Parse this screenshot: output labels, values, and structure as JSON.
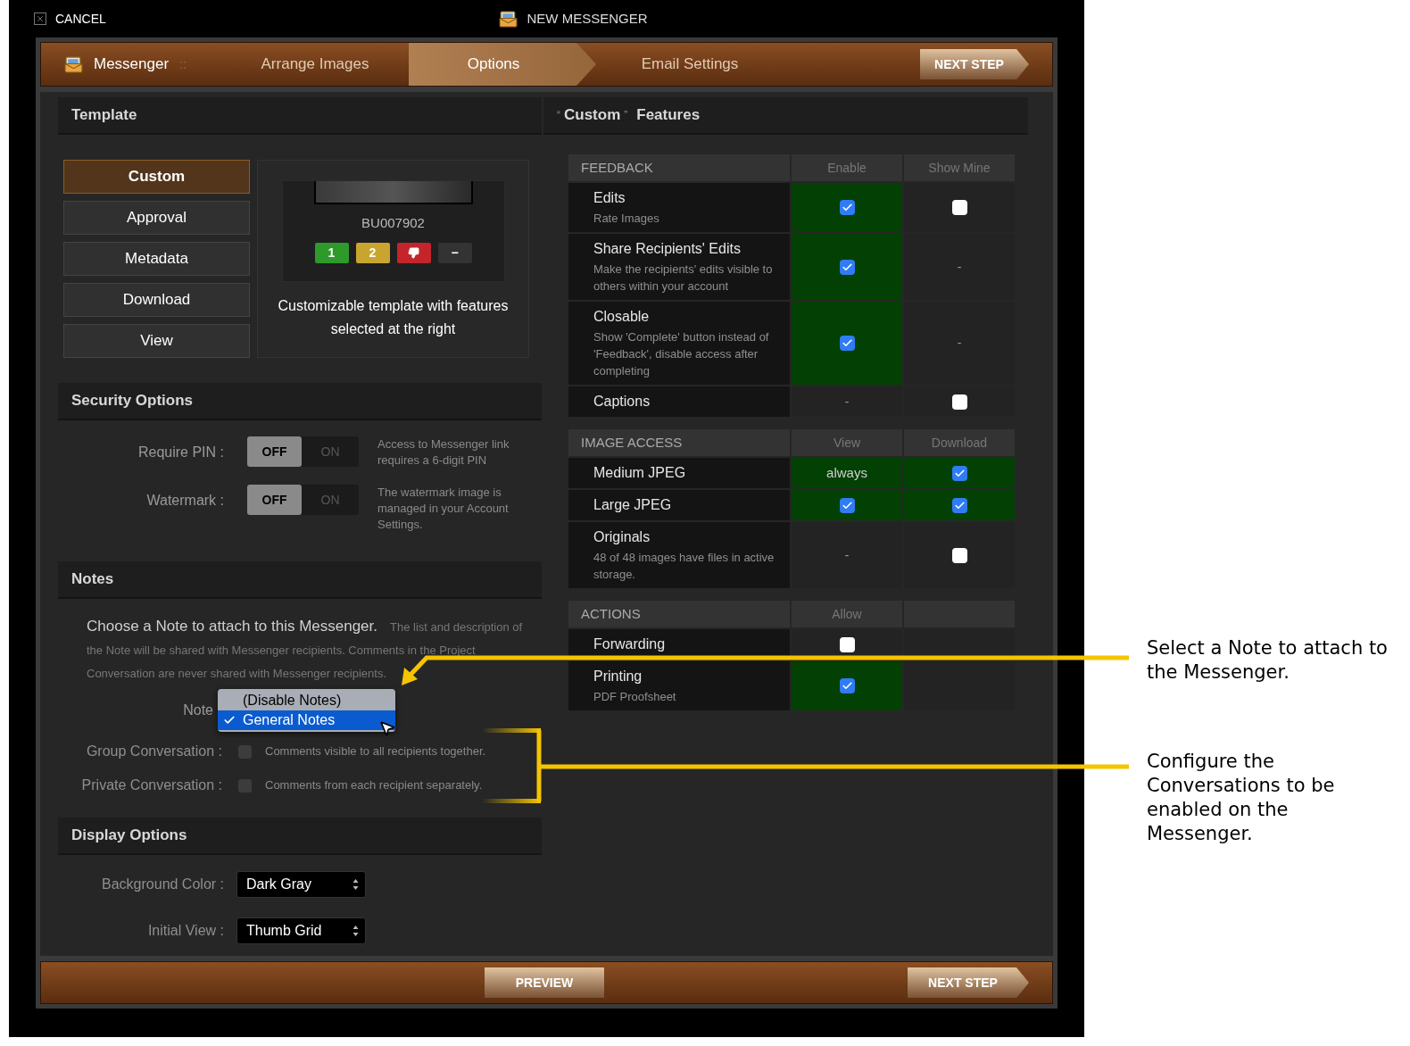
{
  "top_bar": {
    "cancel": "CANCEL",
    "title": "NEW MESSENGER"
  },
  "steps": [
    {
      "kind": "home",
      "label": "Messenger",
      "suffix": "::",
      "selected": false
    },
    {
      "kind": "step",
      "label": "Arrange Images",
      "selected": false
    },
    {
      "kind": "step",
      "label": "Options",
      "selected": true
    },
    {
      "kind": "step",
      "label": "Email Settings",
      "selected": false
    }
  ],
  "next_step": "NEXT STEP",
  "template": {
    "title": "Template",
    "options": [
      {
        "label": "Custom",
        "selected": true
      },
      {
        "label": "Approval",
        "selected": false
      },
      {
        "label": "Metadata",
        "selected": false
      },
      {
        "label": "Download",
        "selected": false
      },
      {
        "label": "View",
        "selected": false
      }
    ],
    "preview": {
      "code": "BU007902",
      "ratings": [
        {
          "kind": "number",
          "label": "1",
          "color": "#2e9a2a"
        },
        {
          "kind": "number",
          "label": "2",
          "color": "#c9a530"
        },
        {
          "kind": "thumbs-down",
          "color": "#c3252a"
        },
        {
          "kind": "number",
          "label": "−",
          "color": "#333333"
        }
      ]
    },
    "description": "Customizable template with features selected at the right"
  },
  "security": {
    "title": "Security Options",
    "rows": [
      {
        "label": "Require PIN :",
        "toggle": {
          "off_label": "OFF",
          "on_label": "ON",
          "on": false
        },
        "description": "Access to Messenger link requires a 6-digit PIN"
      },
      {
        "label": "Watermark :",
        "toggle": {
          "off_label": "OFF",
          "on_label": "ON",
          "on": false
        },
        "description": "The watermark image is managed in your Account Settings."
      }
    ]
  },
  "notes": {
    "title": "Notes",
    "lead": "Choose a Note to attach to this Messenger.",
    "detail": "The list and description of the Note will be shared with Messenger recipients. Comments in the Project Conversation are never shared with Messenger recipients.",
    "note_field": {
      "label": "Note",
      "options": [
        {
          "label": "(Disable Notes)",
          "selected": false
        },
        {
          "label": "General Notes",
          "selected": true
        }
      ]
    },
    "conversations": [
      {
        "label": "Group Conversation :",
        "checked": false,
        "description": "Comments visible to all recipients together."
      },
      {
        "label": "Private Conversation :",
        "checked": false,
        "description": "Comments from each recipient separately."
      }
    ]
  },
  "display": {
    "title": "Display Options",
    "fields": [
      {
        "label": "Background Color :",
        "value": "Dark Gray"
      },
      {
        "label": "Initial View :",
        "value": "Thumb Grid"
      }
    ]
  },
  "features": {
    "quote_open": "“",
    "name": "Custom",
    "quote_close": "”",
    "suffix": "Features",
    "sections": [
      {
        "title": "FEEDBACK",
        "columns": [
          "Enable",
          "Show Mine"
        ],
        "rows": [
          {
            "title": "Edits",
            "subtitle": "Rate Images",
            "cells": [
              {
                "kind": "checkbox",
                "checked": true
              },
              {
                "kind": "checkbox",
                "checked": false
              }
            ]
          },
          {
            "title": "Share Recipients' Edits",
            "subtitle": "Make the recipients' edits visible to others within your account",
            "cells": [
              {
                "kind": "checkbox",
                "checked": true
              },
              {
                "kind": "dash",
                "text": "-"
              }
            ]
          },
          {
            "title": "Closable",
            "subtitle": "Show 'Complete' button instead of 'Feedback', disable access after completing",
            "cells": [
              {
                "kind": "checkbox",
                "checked": true
              },
              {
                "kind": "dash",
                "text": "-"
              }
            ]
          },
          {
            "title": "Captions",
            "cells": [
              {
                "kind": "dash",
                "text": "-"
              },
              {
                "kind": "checkbox",
                "checked": false
              }
            ]
          }
        ]
      },
      {
        "title": "IMAGE ACCESS",
        "columns": [
          "View",
          "Download"
        ],
        "rows": [
          {
            "title": "Medium JPEG",
            "cells": [
              {
                "kind": "text",
                "text": "always"
              },
              {
                "kind": "checkbox",
                "checked": true
              }
            ]
          },
          {
            "title": "Large JPEG",
            "cells": [
              {
                "kind": "checkbox",
                "checked": true
              },
              {
                "kind": "checkbox",
                "checked": true
              }
            ]
          },
          {
            "title": "Originals",
            "subtitle": "48 of 48 images have files in active storage.",
            "cells": [
              {
                "kind": "dash",
                "text": "-"
              },
              {
                "kind": "checkbox",
                "checked": false
              }
            ]
          }
        ]
      },
      {
        "title": "ACTIONS",
        "columns": [
          "Allow"
        ],
        "rows": [
          {
            "title": "Forwarding",
            "cells": [
              {
                "kind": "checkbox",
                "checked": false
              }
            ]
          },
          {
            "title": "Printing",
            "subtitle": "PDF Proofsheet",
            "cells": [
              {
                "kind": "checkbox",
                "checked": true
              }
            ]
          }
        ]
      }
    ]
  },
  "bottom_bar": {
    "preview": "PREVIEW",
    "next_step": "NEXT STEP"
  },
  "callouts": [
    {
      "kind": "arrow",
      "text": "Select a Note to attach to the Messenger."
    },
    {
      "kind": "bracket",
      "text": "Configure the Conversations to be enabled on the Messenger."
    }
  ]
}
